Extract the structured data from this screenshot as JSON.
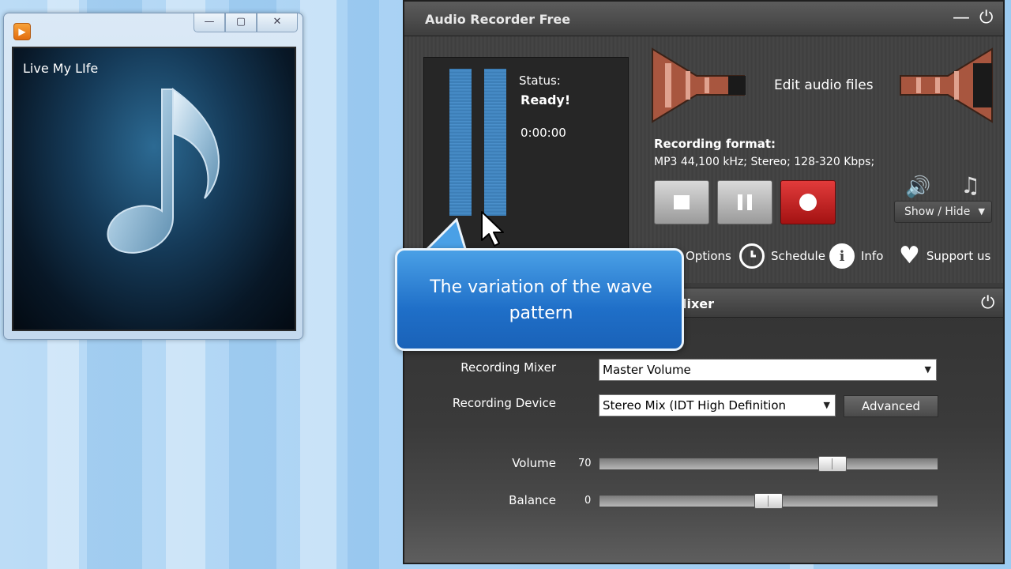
{
  "media_player": {
    "song_title": "Live My LIfe",
    "controls": {
      "minimize": "—",
      "maximize": "▢",
      "close": "✕"
    }
  },
  "recorder": {
    "title": "Audio Recorder Free",
    "status_label": "Status:",
    "status_value": "Ready!",
    "timer": "0:00:00",
    "edit_audio_label": "Edit audio files",
    "format_label": "Recording format:",
    "format_value": "MP3 44,100 kHz; Stereo;  128-320 Kbps;",
    "show_hide_label": "Show / Hide",
    "tools": {
      "options": "Options",
      "schedule": "Schedule",
      "info": "Info",
      "support": "Support us"
    }
  },
  "mixer": {
    "title": "lixer",
    "recording_mixer_label": "Recording Mixer",
    "recording_mixer_value": "Master Volume",
    "recording_device_label": "Recording Device",
    "recording_device_value": "Stereo Mix (IDT High Definition",
    "advanced_label": "Advanced",
    "volume_label": "Volume",
    "volume_value": "70",
    "balance_label": "Balance",
    "balance_value": "0"
  },
  "callout": {
    "text": "The  variation of the wave pattern"
  },
  "colors": {
    "accent_blue": "#2f9ee8",
    "record_red": "#d42626",
    "meter_blue": "#4a8fca"
  }
}
